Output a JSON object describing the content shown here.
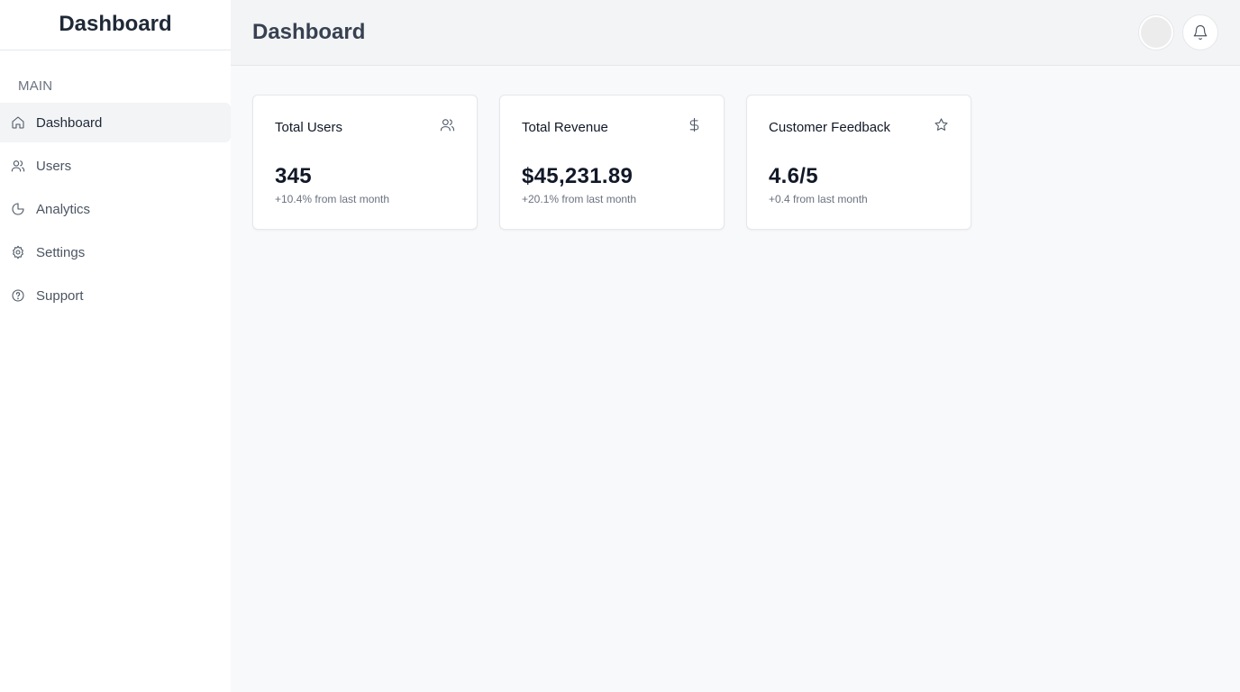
{
  "sidebar": {
    "brand": "Dashboard",
    "section_label": "MAIN",
    "items": [
      {
        "label": "Dashboard",
        "icon": "home-icon",
        "active": true
      },
      {
        "label": "Users",
        "icon": "users-icon",
        "active": false
      },
      {
        "label": "Analytics",
        "icon": "pie-chart-icon",
        "active": false
      },
      {
        "label": "Settings",
        "icon": "gear-icon",
        "active": false
      },
      {
        "label": "Support",
        "icon": "help-circle-icon",
        "active": false
      }
    ]
  },
  "header": {
    "title": "Dashboard",
    "avatar_icon": "avatar",
    "notification_icon": "bell-icon"
  },
  "cards": [
    {
      "title": "Total Users",
      "icon": "users-icon",
      "value": "345",
      "note": "+10.4% from last month"
    },
    {
      "title": "Total Revenue",
      "icon": "dollar-icon",
      "value": "$45,231.89",
      "note": "+20.1% from last month"
    },
    {
      "title": "Customer Feedback",
      "icon": "star-icon",
      "value": "4.6/5",
      "note": "+0.4 from last month"
    }
  ],
  "colors": {
    "sidebar_bg": "#ffffff",
    "main_bg": "#f8f9fb",
    "header_bg": "#f3f4f6",
    "active_item_bg": "#f3f4f6",
    "text_primary": "#111827",
    "text_muted": "#6b7280"
  }
}
